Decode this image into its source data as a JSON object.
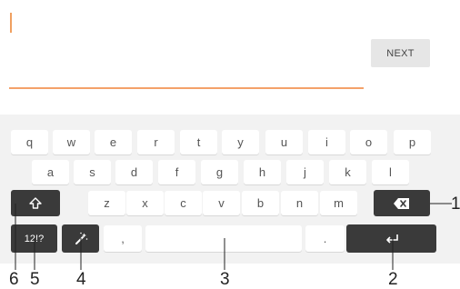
{
  "input": {
    "next_label": "NEXT"
  },
  "keyboard": {
    "row1": [
      "q",
      "w",
      "e",
      "r",
      "t",
      "y",
      "u",
      "i",
      "o",
      "p"
    ],
    "row2": [
      "a",
      "s",
      "d",
      "f",
      "g",
      "h",
      "j",
      "k",
      "l"
    ],
    "row3": [
      "z",
      "x",
      "c",
      "v",
      "b",
      "n",
      "m"
    ],
    "shift_icon": "shift-arrow-icon",
    "backspace_icon": "backspace-icon",
    "symbols_label": "12!?",
    "input_tools_icon": "magic-wand-icon",
    "comma_label": ",",
    "period_label": ".",
    "enter_icon": "enter-arrow-icon"
  },
  "callouts": [
    "1",
    "2",
    "3",
    "4",
    "5",
    "6"
  ]
}
